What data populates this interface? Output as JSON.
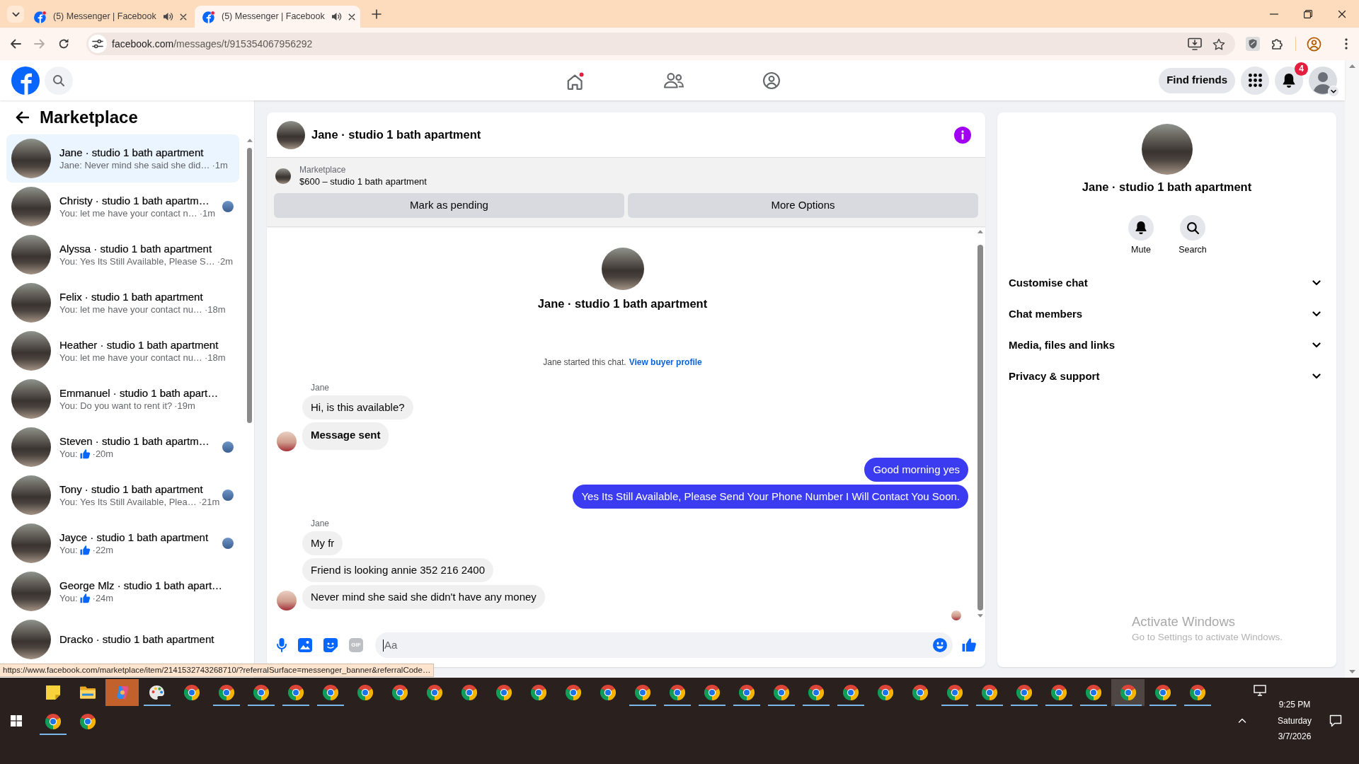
{
  "browser": {
    "tabs": [
      {
        "title": "(5) Messenger | Facebook",
        "unread": true,
        "audio": true,
        "selected": false
      },
      {
        "title": "(5) Messenger | Facebook",
        "unread": true,
        "audio": true,
        "selected": true
      }
    ],
    "nav": [
      {
        "kind": "back",
        "disabled": false
      },
      {
        "kind": "forward",
        "disabled": true
      },
      {
        "kind": "reload",
        "disabled": false
      }
    ],
    "address": {
      "host": "facebook.com",
      "path": "/messages/t/915354067956292"
    }
  },
  "top_bar": {
    "nav": [
      {
        "kind": "home",
        "dot": true
      },
      {
        "kind": "friends",
        "dot": false
      },
      {
        "kind": "groups",
        "dot": false
      }
    ],
    "find_friends": "Find friends",
    "notifications": "4"
  },
  "sidebar": {
    "title": "Marketplace",
    "conversations": [
      {
        "name": "Jane · studio 1 bath apartment",
        "preview": {
          "kind": "text",
          "text": "Jane: Never mind she said she did…"
        },
        "time": "·1m",
        "selected": true,
        "seen": false
      },
      {
        "name": "Christy · studio 1 bath apartm…",
        "preview": {
          "kind": "text",
          "text": "You: let me have your contact n…"
        },
        "time": "·1m",
        "selected": false,
        "seen": true
      },
      {
        "name": "Alyssa · studio 1 bath apartment",
        "preview": {
          "kind": "text",
          "text": "You: Yes Its Still Available, Please S…"
        },
        "time": "·2m",
        "selected": false,
        "seen": false
      },
      {
        "name": "Felix · studio 1 bath apartment",
        "preview": {
          "kind": "text",
          "text": "You: let me have your contact nu…"
        },
        "time": "·18m",
        "selected": false,
        "seen": false
      },
      {
        "name": "Heather · studio 1 bath apartment",
        "preview": {
          "kind": "text",
          "text": "You: let me have your contact nu…"
        },
        "time": "·18m",
        "selected": false,
        "seen": false
      },
      {
        "name": "Emmanuel · studio 1 bath apart…",
        "preview": {
          "kind": "text",
          "text": "You: Do you want to rent it?"
        },
        "time": "·19m",
        "selected": false,
        "seen": false
      },
      {
        "name": "Steven · studio 1 bath apartm…",
        "preview": {
          "kind": "like",
          "text": "You:"
        },
        "time": "·20m",
        "selected": false,
        "seen": true
      },
      {
        "name": "Tony · studio 1 bath apartment",
        "preview": {
          "kind": "text",
          "text": "You: Yes Its Still Available, Plea…"
        },
        "time": "·21m",
        "selected": false,
        "seen": true
      },
      {
        "name": "Jayce · studio 1 bath apartment",
        "preview": {
          "kind": "like",
          "text": "You:"
        },
        "time": "·22m",
        "selected": false,
        "seen": true
      },
      {
        "name": "George Mlz · studio 1 bath apart…",
        "preview": {
          "kind": "like",
          "text": "You:"
        },
        "time": "·24m",
        "selected": false,
        "seen": false
      },
      {
        "name": "Dracko · studio 1 bath apartment",
        "selected": false,
        "seen": false
      }
    ]
  },
  "chat": {
    "title": "Jane · studio 1 bath apartment",
    "listing": {
      "source": "Marketplace",
      "title": "$600 – studio 1 bath apartment"
    },
    "actions": [
      "Mark as pending",
      "More Options"
    ],
    "intro": {
      "name": "Jane · studio 1 bath apartment",
      "started": "Jane started this chat.",
      "link": "View buyer profile"
    },
    "groups": [
      {
        "sender": "Jane",
        "kind": "incoming",
        "messages": [
          {
            "text": "Hi, is this available?",
            "bold": false
          },
          {
            "text": "Message sent",
            "bold": true
          }
        ]
      },
      {
        "kind": "outgoing",
        "messages": [
          {
            "text": "Good morning yes",
            "bold": false
          },
          {
            "text": "Yes Its Still Available, Please Send Your Phone Number I Will Contact You Soon.",
            "bold": false
          }
        ]
      },
      {
        "sender": "Jane",
        "kind": "incoming",
        "messages": [
          {
            "text": "My fr",
            "bold": false
          },
          {
            "text": "Friend is looking annie 352 216 2400",
            "bold": false
          },
          {
            "text": "Never mind she said she didn't have any money",
            "bold": false
          }
        ]
      }
    ],
    "seen": true,
    "composer": {
      "tools": [
        {
          "kind": "mic"
        },
        {
          "kind": "image"
        },
        {
          "kind": "sticker"
        },
        {
          "kind": "gif",
          "label": "GIF"
        }
      ],
      "placeholder": "Aa"
    }
  },
  "details": {
    "name": "Jane · studio 1 bath apartment",
    "actions": [
      {
        "kind": "mute",
        "label": "Mute"
      },
      {
        "kind": "search",
        "label": "Search"
      }
    ],
    "sections": [
      {
        "label": "Customise chat",
        "expanded": false
      },
      {
        "label": "Chat members",
        "expanded": false
      },
      {
        "label": "Media, files and links",
        "expanded": false
      },
      {
        "label": "Privacy & support",
        "expanded": false
      }
    ]
  },
  "link_preview": "https://www.facebook.com/marketplace/item/2141532743268710/?referralSurface=messenger_banner&referralCode…",
  "os_notice": {
    "title": "Activate Windows",
    "subtitle": "Go to Settings to activate Windows."
  },
  "taskbar": {
    "rows": [
      [
        {
          "kind": "notes",
          "running": false,
          "attention": false,
          "selected": false
        },
        {
          "kind": "folder",
          "running": false,
          "attention": false,
          "selected": false
        },
        {
          "kind": "assistant",
          "running": false,
          "attention": true,
          "selected": false
        },
        {
          "kind": "paint",
          "running": true,
          "attention": false,
          "selected": false
        },
        {
          "kind": "browser",
          "running": false,
          "attention": false,
          "selected": false
        },
        {
          "kind": "browser",
          "running": true,
          "attention": false,
          "selected": false
        },
        {
          "kind": "browser",
          "running": true,
          "attention": false,
          "selected": false
        },
        {
          "kind": "browser",
          "running": true,
          "attention": false,
          "selected": false
        },
        {
          "kind": "browser",
          "running": true,
          "attention": false,
          "selected": false
        },
        {
          "kind": "browser",
          "running": false,
          "attention": false,
          "selected": false
        },
        {
          "kind": "browser",
          "running": false,
          "attention": false,
          "selected": false
        },
        {
          "kind": "browser",
          "running": false,
          "attention": false,
          "selected": false
        },
        {
          "kind": "browser",
          "running": false,
          "attention": false,
          "selected": false
        },
        {
          "kind": "browser",
          "running": false,
          "attention": false,
          "selected": false
        },
        {
          "kind": "browser",
          "running": false,
          "attention": false,
          "selected": false
        },
        {
          "kind": "browser",
          "running": false,
          "attention": false,
          "selected": false
        },
        {
          "kind": "browser",
          "running": false,
          "attention": false,
          "selected": false
        },
        {
          "kind": "browser",
          "running": true,
          "attention": false,
          "selected": false
        },
        {
          "kind": "browser",
          "running": true,
          "attention": false,
          "selected": false
        },
        {
          "kind": "browser",
          "running": true,
          "attention": false,
          "selected": false
        },
        {
          "kind": "browser",
          "running": true,
          "attention": false,
          "selected": false
        },
        {
          "kind": "browser",
          "running": true,
          "attention": false,
          "selected": false
        },
        {
          "kind": "browser",
          "running": true,
          "attention": false,
          "selected": false
        },
        {
          "kind": "browser",
          "running": true,
          "attention": false,
          "selected": false
        },
        {
          "kind": "browser",
          "running": false,
          "attention": false,
          "selected": false
        },
        {
          "kind": "browser",
          "running": false,
          "attention": false,
          "selected": false
        },
        {
          "kind": "browser",
          "running": true,
          "attention": false,
          "selected": false
        },
        {
          "kind": "browser",
          "running": true,
          "attention": false,
          "selected": false
        },
        {
          "kind": "browser",
          "running": true,
          "attention": false,
          "selected": false
        },
        {
          "kind": "browser",
          "running": true,
          "attention": false,
          "selected": false
        },
        {
          "kind": "browser",
          "running": true,
          "attention": false,
          "selected": false
        },
        {
          "kind": "browser",
          "running": true,
          "attention": false,
          "selected": true
        },
        {
          "kind": "browser",
          "running": true,
          "attention": false,
          "selected": false
        },
        {
          "kind": "browser",
          "running": true,
          "attention": false,
          "selected": false
        }
      ],
      [
        {
          "kind": "browser",
          "running": true,
          "attention": false,
          "selected": false
        },
        {
          "kind": "browser",
          "running": false,
          "attention": false,
          "selected": false
        }
      ]
    ],
    "clock": {
      "time": "9:25 PM",
      "day": "Saturday",
      "date": "3/7/2026"
    }
  }
}
